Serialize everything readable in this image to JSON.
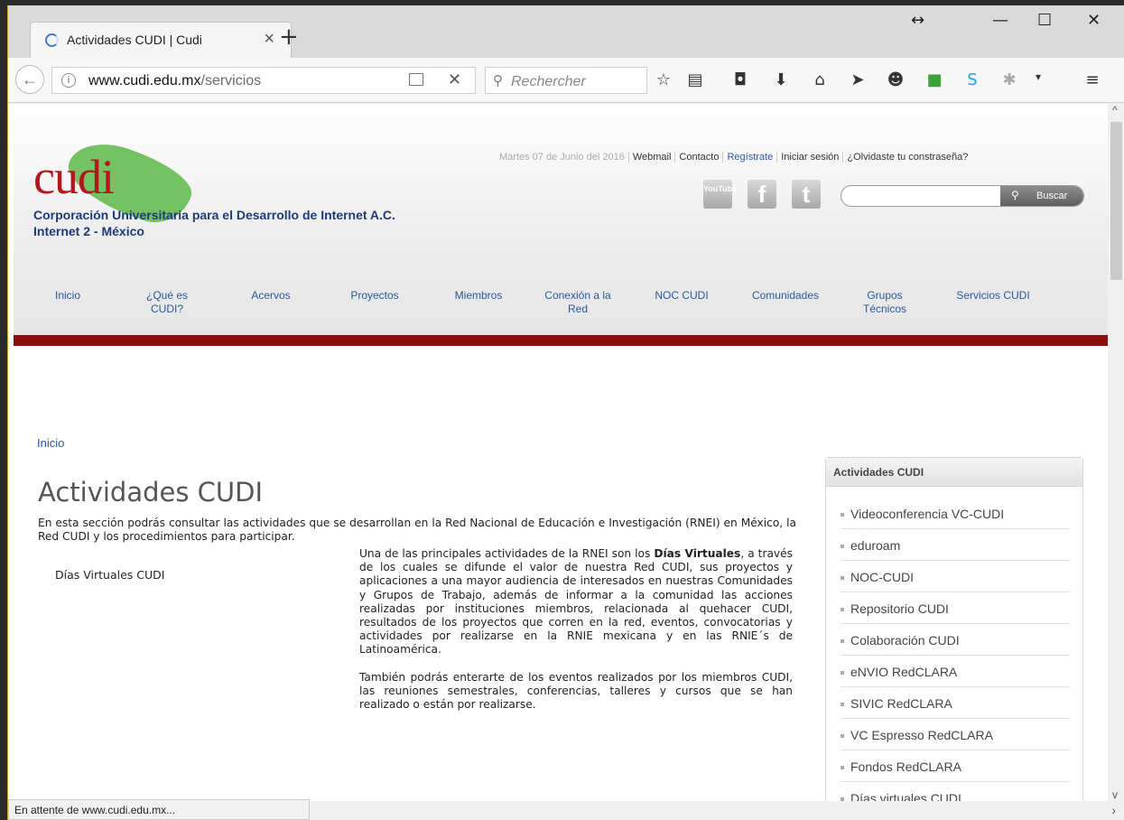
{
  "browser": {
    "tab_title": "Actividades CUDI | Cudi",
    "url_domain": "www.cudi.edu.mx",
    "url_path": "/servicios",
    "search_placeholder": "Rechercher",
    "status": "En attente de www.cudi.edu.mx..."
  },
  "site": {
    "logo_text": "cudi",
    "org_name": "Corporación Universitaria para el Desarrollo de Internet A.C.",
    "org_sub": "Internet 2 - México",
    "date": "Martes 07 de Junio del 2016",
    "top_links": [
      "Webmail",
      "Contacto",
      "Regístrate",
      "Iniciar sesión",
      "¿Olvidaste tu constraseña?"
    ],
    "social": [
      "YouTube",
      "f",
      "t"
    ],
    "search_button": "Buscar",
    "nav": [
      {
        "line1": "Inicio",
        "line2": ""
      },
      {
        "line1": "¿Qué es",
        "line2": "CUDI?"
      },
      {
        "line1": "Acervos",
        "line2": ""
      },
      {
        "line1": "Proyectos",
        "line2": ""
      },
      {
        "line1": "Miembros",
        "line2": ""
      },
      {
        "line1": "Conexión a la",
        "line2": "Red"
      },
      {
        "line1": "NOC CUDI",
        "line2": ""
      },
      {
        "line1": "Comunidades",
        "line2": ""
      },
      {
        "line1": "Grupos",
        "line2": "Técnicos"
      },
      {
        "line1": "Servicios CUDI",
        "line2": ""
      }
    ]
  },
  "content": {
    "breadcrumb": "Inicio",
    "title": "Actividades CUDI",
    "intro": "En esta sección podrás consultar las actividades que se desarrollan en la Red Nacional de Educación e Investigación (RNEI) en México, la Red CUDI y los procedimientos para participar.",
    "left_label": "Días Virtuales CUDI",
    "para1_pre": "Una de las principales actividades de la RNEI son los ",
    "para1_bold": "Días Virtuales",
    "para1_post": ", a través de los cuales se difunde el valor de nuestra Red CUDI, sus proyectos y aplicaciones a una mayor audiencia de interesados en nuestras Comunidades y Grupos de Trabajo, además de informar a la comunidad las acciones realizadas por instituciones miembros, relacionada al quehacer CUDI, resultados de los proyectos que corren en la red, eventos, convocatorias y actividades por realizarse en la RNIE mexicana y en las RNIE´s de Latinoamérica.",
    "para2": "También podrás enterarte de los eventos realizados por los miembros CUDI, las reuniones semestrales, conferencias, talleres y cursos que se han realizado o están por realizarse."
  },
  "sidebar": {
    "title": "Actividades CUDI",
    "items": [
      "Videoconferencia VC-CUDI",
      "eduroam",
      "NOC-CUDI",
      "Repositorio CUDI",
      "Colaboración CUDI",
      "eNVIO RedCLARA",
      "SIVIC RedCLARA",
      "VC Espresso RedCLARA",
      "Fondos RedCLARA",
      "Días virtuales CUDI"
    ]
  }
}
